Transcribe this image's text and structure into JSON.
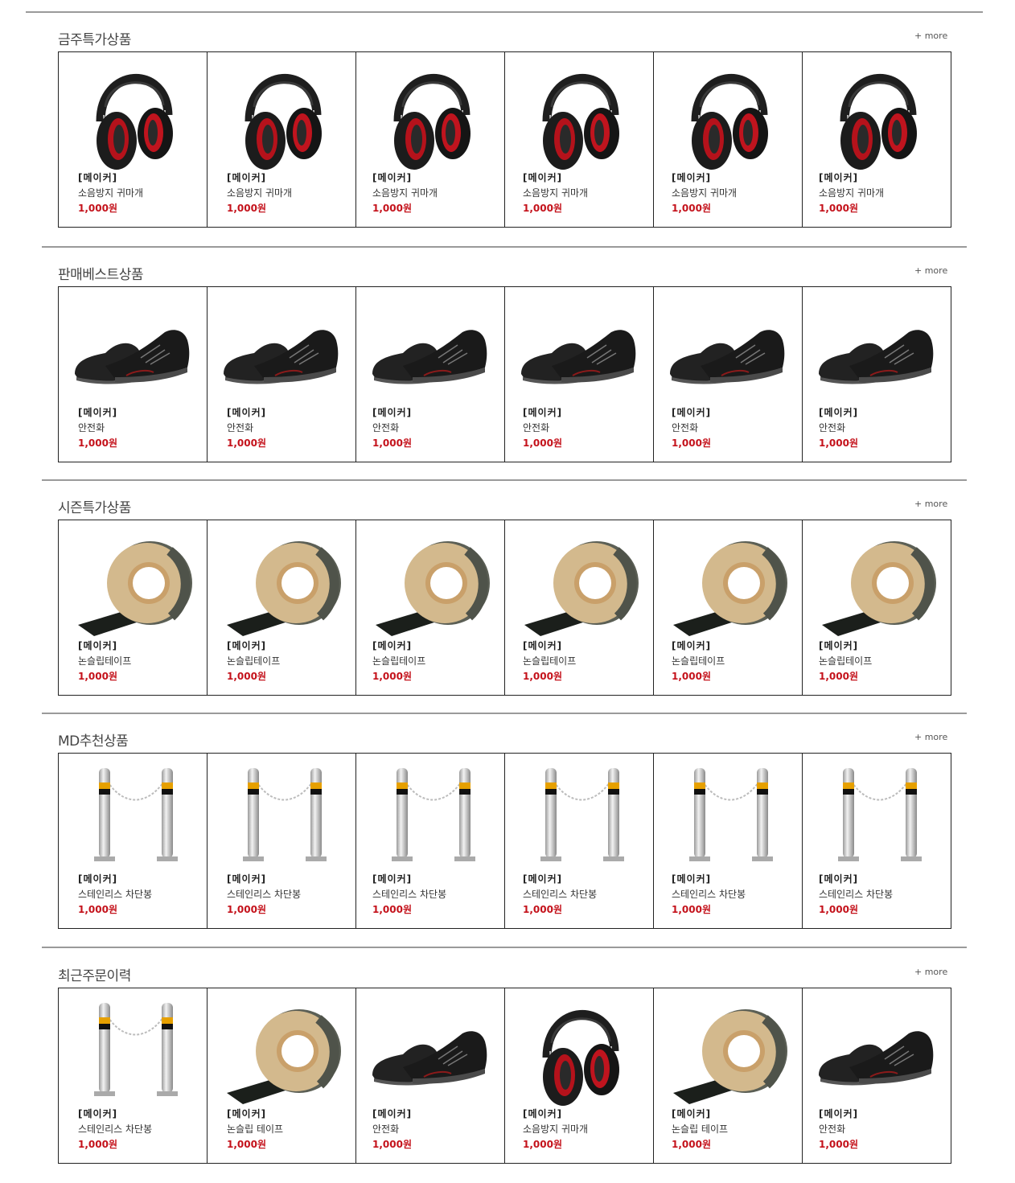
{
  "sections": [
    {
      "title": "금주특가상품",
      "more": "+ more",
      "products": [
        {
          "maker": "[메이커]",
          "name": "소음방지 귀마개",
          "price": "1,000원",
          "icon": "earmuff"
        },
        {
          "maker": "[메이커]",
          "name": "소음방지 귀마개",
          "price": "1,000원",
          "icon": "earmuff"
        },
        {
          "maker": "[메이커]",
          "name": "소음방지 귀마개",
          "price": "1,000원",
          "icon": "earmuff"
        },
        {
          "maker": "[메이커]",
          "name": "소음방지 귀마개",
          "price": "1,000원",
          "icon": "earmuff"
        },
        {
          "maker": "[메이커]",
          "name": "소음방지 귀마개",
          "price": "1,000원",
          "icon": "earmuff"
        },
        {
          "maker": "[메이커]",
          "name": "소음방지 귀마개",
          "price": "1,000원",
          "icon": "earmuff"
        }
      ]
    },
    {
      "title": "판매베스트상품",
      "more": "+ more",
      "products": [
        {
          "maker": "[메이커]",
          "name": "안전화",
          "price": "1,000원",
          "icon": "shoe"
        },
        {
          "maker": "[메이커]",
          "name": "안전화",
          "price": "1,000원",
          "icon": "shoe"
        },
        {
          "maker": "[메이커]",
          "name": "안전화",
          "price": "1,000원",
          "icon": "shoe"
        },
        {
          "maker": "[메이커]",
          "name": "안전화",
          "price": "1,000원",
          "icon": "shoe"
        },
        {
          "maker": "[메이커]",
          "name": "안전화",
          "price": "1,000원",
          "icon": "shoe"
        },
        {
          "maker": "[메이커]",
          "name": "안전화",
          "price": "1,000원",
          "icon": "shoe"
        }
      ]
    },
    {
      "title": "시즌특가상품",
      "more": "+ more",
      "products": [
        {
          "maker": "[메이커]",
          "name": "논슬립테이프",
          "price": "1,000원",
          "icon": "tape"
        },
        {
          "maker": "[메이커]",
          "name": "논슬립테이프",
          "price": "1,000원",
          "icon": "tape"
        },
        {
          "maker": "[메이커]",
          "name": "논슬립테이프",
          "price": "1,000원",
          "icon": "tape"
        },
        {
          "maker": "[메이커]",
          "name": "논슬립테이프",
          "price": "1,000원",
          "icon": "tape"
        },
        {
          "maker": "[메이커]",
          "name": "논슬립테이프",
          "price": "1,000원",
          "icon": "tape"
        },
        {
          "maker": "[메이커]",
          "name": "논슬립테이프",
          "price": "1,000원",
          "icon": "tape"
        }
      ]
    },
    {
      "title": "MD추천상품",
      "more": "+ more",
      "products": [
        {
          "maker": "[메이커]",
          "name": "스테인리스 차단봉",
          "price": "1,000원",
          "icon": "bollard"
        },
        {
          "maker": "[메이커]",
          "name": "스테인리스 차단봉",
          "price": "1,000원",
          "icon": "bollard"
        },
        {
          "maker": "[메이커]",
          "name": "스테인리스 차단봉",
          "price": "1,000원",
          "icon": "bollard"
        },
        {
          "maker": "[메이커]",
          "name": "스테인리스 차단봉",
          "price": "1,000원",
          "icon": "bollard"
        },
        {
          "maker": "[메이커]",
          "name": "스테인리스 차단봉",
          "price": "1,000원",
          "icon": "bollard"
        },
        {
          "maker": "[메이커]",
          "name": "스테인리스 차단봉",
          "price": "1,000원",
          "icon": "bollard"
        }
      ]
    },
    {
      "title": "최근주문이력",
      "more": "+ more",
      "products": [
        {
          "maker": "[메이커]",
          "name": "스테인리스 차단봉",
          "price": "1,000원",
          "icon": "bollard"
        },
        {
          "maker": "[메이커]",
          "name": "논슬립 테이프",
          "price": "1,000원",
          "icon": "tape"
        },
        {
          "maker": "[메이커]",
          "name": "안전화",
          "price": "1,000원",
          "icon": "shoe"
        },
        {
          "maker": "[메이커]",
          "name": "소음방지 귀마개",
          "price": "1,000원",
          "icon": "earmuff"
        },
        {
          "maker": "[메이커]",
          "name": "논슬립 테이프",
          "price": "1,000원",
          "icon": "tape"
        },
        {
          "maker": "[메이커]",
          "name": "안전화",
          "price": "1,000원",
          "icon": "shoe"
        }
      ]
    }
  ],
  "colors": {
    "price": "#c4121b",
    "border": "#222222",
    "divider": "#9a9a9a"
  }
}
